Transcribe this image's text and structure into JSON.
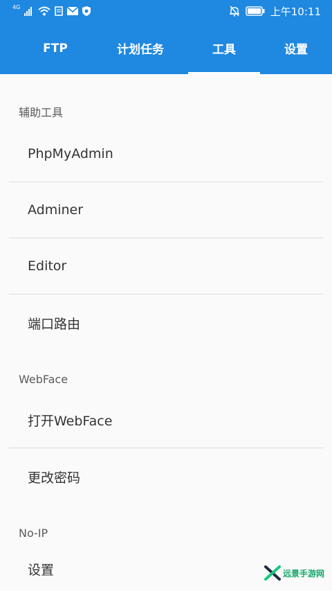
{
  "status_bar": {
    "network": "4G",
    "time": "上午10:11"
  },
  "tabs": [
    {
      "label": "FTP",
      "active": false
    },
    {
      "label": "计划任务",
      "active": false
    },
    {
      "label": "工具",
      "active": true
    },
    {
      "label": "设置",
      "active": false
    }
  ],
  "sections": {
    "aux": {
      "header": "辅助工具",
      "items": [
        "PhpMyAdmin",
        "Adminer",
        "Editor",
        "端口路由"
      ]
    },
    "webface": {
      "header": "WebFace",
      "items": [
        "打开WebFace",
        "更改密码"
      ]
    },
    "noip": {
      "header": "No-IP",
      "items": [
        "设置"
      ]
    }
  },
  "watermark": {
    "text": "远景手游网"
  },
  "colors": {
    "app_bar": "#1f88e0",
    "background": "#fafafa",
    "divider": "#dcdcdc",
    "watermark": "#17a86b"
  }
}
